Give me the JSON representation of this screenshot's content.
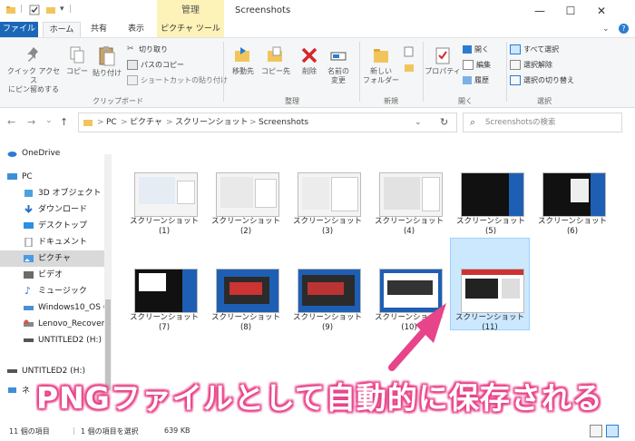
{
  "titlebar": {
    "manage_tab": "管理",
    "window_title": "Screenshots",
    "minimize": "—",
    "maximize": "☐",
    "close": "✕"
  },
  "tabs": {
    "file": "ファイル",
    "home": "ホーム",
    "share": "共有",
    "view": "表示",
    "picture_tools": "ピクチャ ツール"
  },
  "ribbon": {
    "pin_quick_access": "クイック アクセス\nにピン留めする",
    "copy": "コピー",
    "paste": "貼り付け",
    "cut": "切り取り",
    "copy_path": "パスのコピー",
    "paste_shortcut": "ショートカットの貼り付け",
    "clipboard_group": "クリップボード",
    "move_to": "移動先",
    "copy_to": "コピー先",
    "delete": "削除",
    "rename": "名前の\n変更",
    "organize_group": "整理",
    "new_folder": "新しい\nフォルダー",
    "new_group": "新規",
    "properties": "プロパティ",
    "open": "開く",
    "edit": "編集",
    "history": "履歴",
    "open_group": "開く",
    "select_all": "すべて選択",
    "select_none": "選択解除",
    "invert_selection": "選択の切り替え",
    "select_group": "選択"
  },
  "address": {
    "back": "←",
    "forward": "→",
    "recent": "⌄",
    "up": "↑",
    "crumbs": [
      "PC",
      "ピクチャ",
      "スクリーンショット",
      "Screenshots"
    ],
    "separator": ">",
    "refresh": "↻",
    "search_placeholder": "Screenshotsの検索"
  },
  "nav": {
    "items": [
      {
        "label": "OneDrive",
        "icon": "cloud-icon",
        "color": "#2b7cd3"
      },
      {
        "label": "PC",
        "icon": "pc-icon",
        "color": "#3c8fd8"
      },
      {
        "label": "3D オブジェクト",
        "icon": "cube-icon",
        "color": "#4aa3df"
      },
      {
        "label": "ダウンロード",
        "icon": "download-icon",
        "color": "#2a6fc2"
      },
      {
        "label": "デスクトップ",
        "icon": "desktop-icon",
        "color": "#2d8fe0"
      },
      {
        "label": "ドキュメント",
        "icon": "document-icon",
        "color": "#7a7a7a"
      },
      {
        "label": "ピクチャ",
        "icon": "picture-icon",
        "color": "#4c9be0"
      },
      {
        "label": "ビデオ",
        "icon": "video-icon",
        "color": "#6b6b6b"
      },
      {
        "label": "ミュージック",
        "icon": "music-icon",
        "color": "#2b7cd3"
      },
      {
        "label": "Windows10_OS (C",
        "icon": "drive-icon",
        "color": "#4a90d9"
      },
      {
        "label": "Lenovo_Recover",
        "icon": "drive-icon",
        "color": "#d9534f"
      },
      {
        "label": "UNTITLED2 (H:)",
        "icon": "usb-drive-icon",
        "color": "#555555"
      },
      {
        "label": "UNTITLED2 (H:)",
        "icon": "usb-drive-icon",
        "color": "#555555"
      },
      {
        "label": "ネ",
        "icon": "network-icon",
        "color": "#3c8fd8"
      }
    ]
  },
  "files": [
    {
      "name": "スクリーンショット",
      "num": "(1)",
      "thumb": "light"
    },
    {
      "name": "スクリーンショット",
      "num": "(2)",
      "thumb": "light"
    },
    {
      "name": "スクリーンショット",
      "num": "(3)",
      "thumb": "light"
    },
    {
      "name": "スクリーンショット",
      "num": "(4)",
      "thumb": "light"
    },
    {
      "name": "スクリーンショット",
      "num": "(5)",
      "thumb": "dark"
    },
    {
      "name": "スクリーンショット",
      "num": "(6)",
      "thumb": "dark"
    },
    {
      "name": "スクリーンショット",
      "num": "(7)",
      "thumb": "dark"
    },
    {
      "name": "スクリーンショット",
      "num": "(8)",
      "thumb": "blue"
    },
    {
      "name": "スクリーンショット",
      "num": "(9)",
      "thumb": "blue"
    },
    {
      "name": "スクリーンショット",
      "num": "(10)",
      "thumb": "red"
    },
    {
      "name": "スクリーンショット",
      "num": "(11)",
      "thumb": "red",
      "selected": true
    }
  ],
  "status": {
    "item_count": "11 個の項目",
    "selected": "1 個の項目を選択",
    "size": "639 KB"
  },
  "callout": {
    "text": "PNGファイルとして自動的に保存される"
  },
  "colors": {
    "accent": "#1a66b8",
    "callout_pink": "#e8448a",
    "selection": "#cce8ff"
  }
}
